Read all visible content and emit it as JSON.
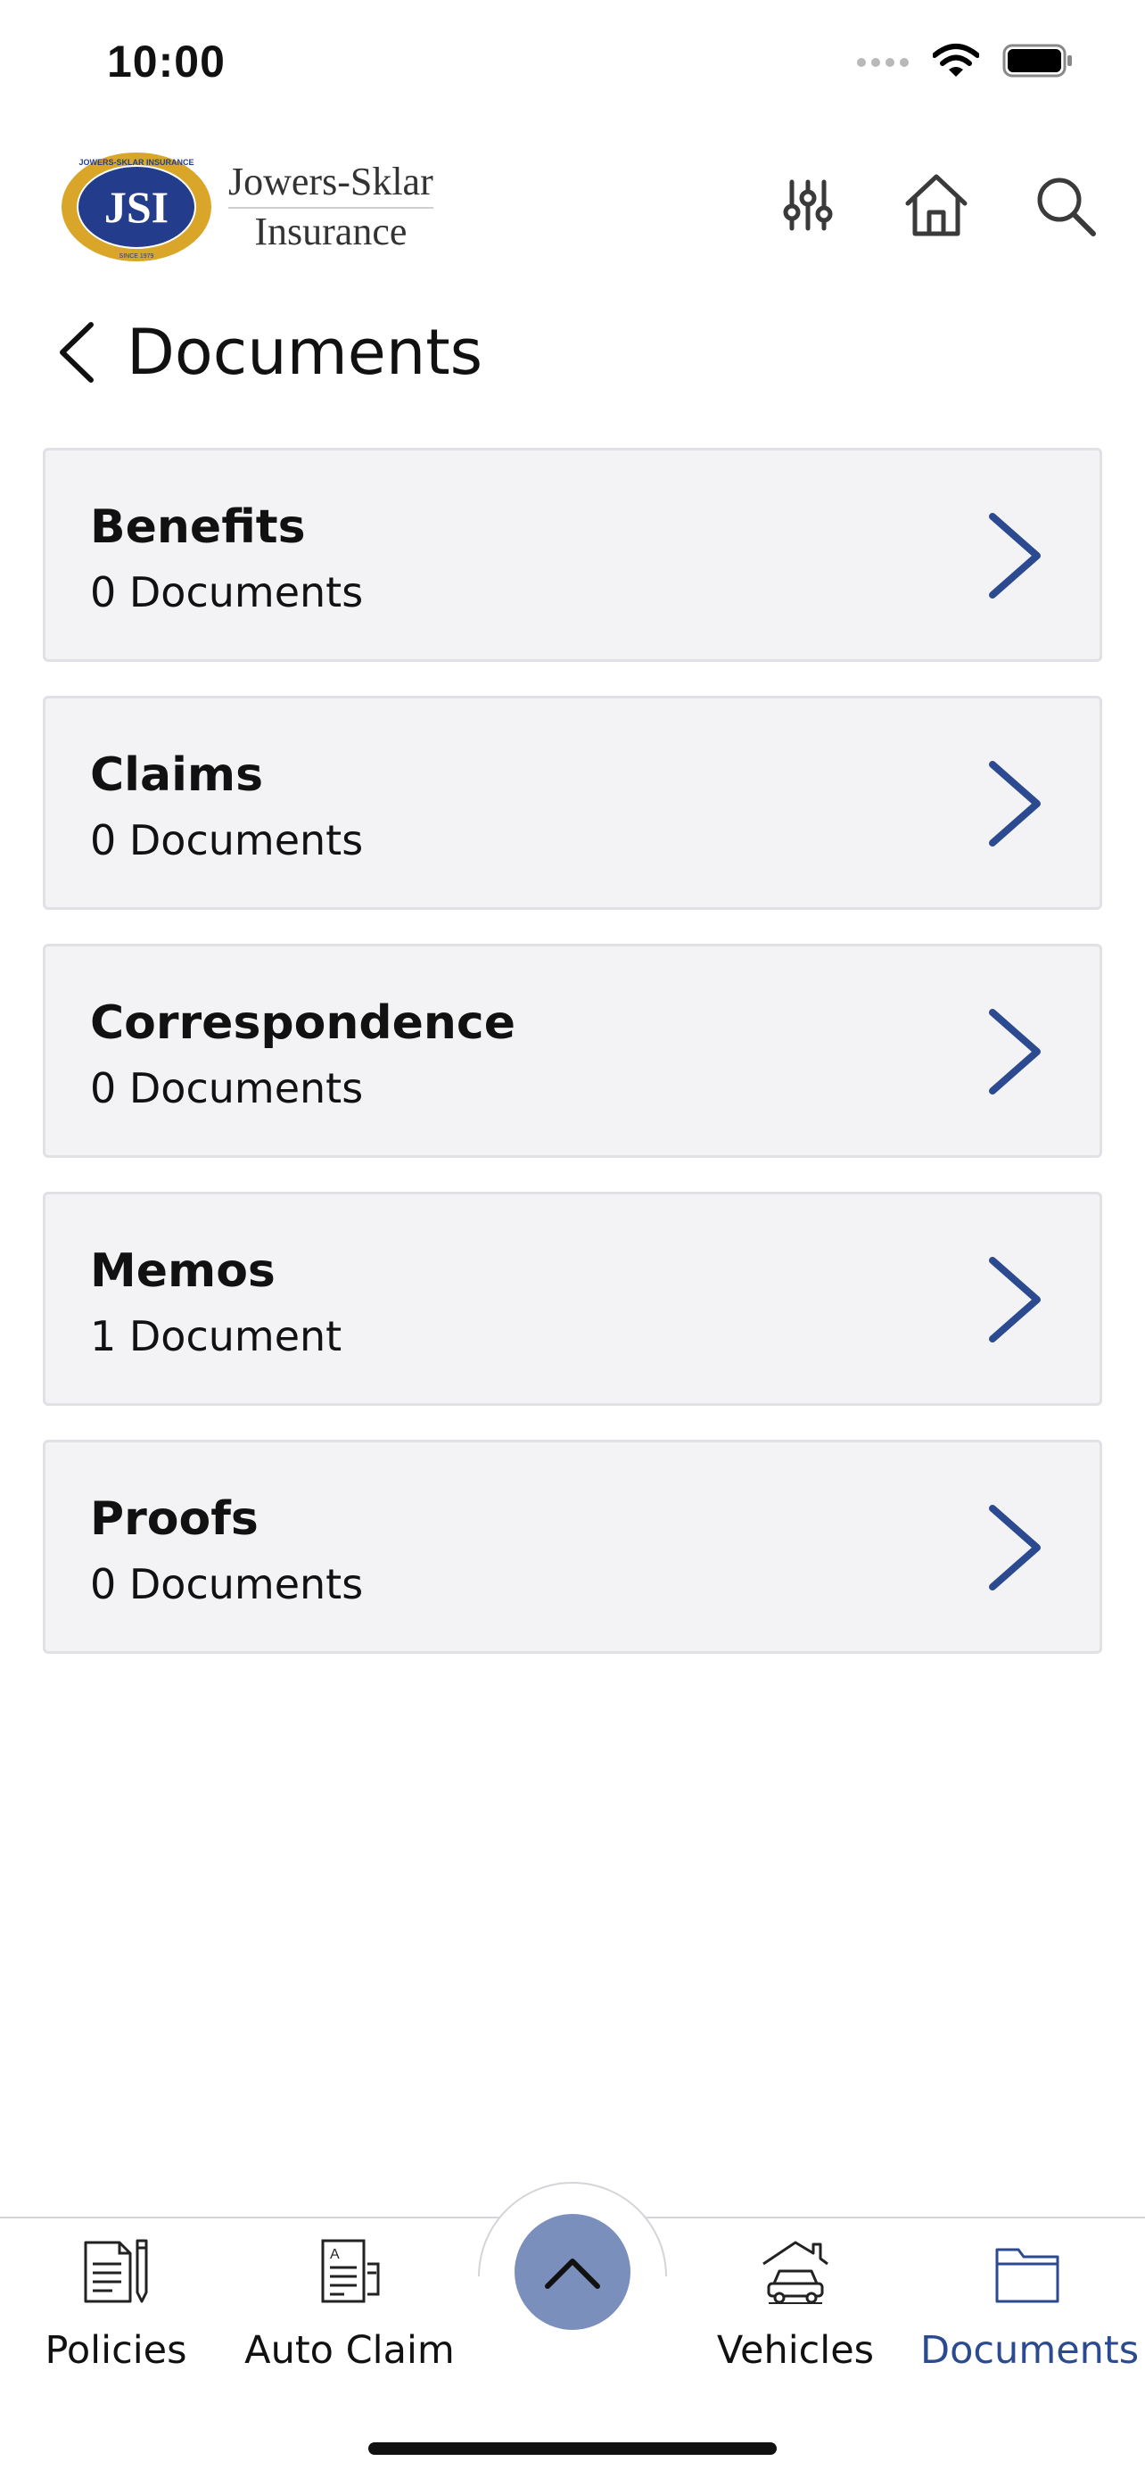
{
  "status_bar": {
    "time": "10:00",
    "icons": [
      "cellular-dots-icon",
      "wifi-icon",
      "battery-icon"
    ]
  },
  "header": {
    "logo_monogram": "JSI",
    "logo_ring_text": "JOWERS-SKLAR INSURANCE",
    "logo_since": "SINCE 1979",
    "logo_line1": "Jowers-Sklar",
    "logo_line2": "Insurance",
    "actions": [
      "sliders-icon",
      "home-icon",
      "search-icon"
    ]
  },
  "page": {
    "title": "Documents"
  },
  "documents": [
    {
      "name": "Benefits",
      "count": "0 Documents"
    },
    {
      "name": "Claims",
      "count": "0 Documents"
    },
    {
      "name": "Correspondence",
      "count": "0 Documents"
    },
    {
      "name": "Memos",
      "count": "1 Document"
    },
    {
      "name": "Proofs",
      "count": "0 Documents"
    }
  ],
  "tabbar": {
    "tabs": [
      {
        "label": "Policies",
        "icon": "policy-doc-icon",
        "active": false
      },
      {
        "label": "Auto Claim",
        "icon": "claim-form-icon",
        "active": false
      },
      {
        "label": "Vehicles",
        "icon": "car-garage-icon",
        "active": false
      },
      {
        "label": "Documents",
        "icon": "folder-icon",
        "active": true
      }
    ],
    "fab_icon": "chevron-up-icon"
  },
  "colors": {
    "accent": "#2b4a8f",
    "fab": "#7b8fbd",
    "card_bg": "#f3f3f6",
    "logo_gold": "#d9a62a",
    "logo_blue": "#233d8c"
  }
}
